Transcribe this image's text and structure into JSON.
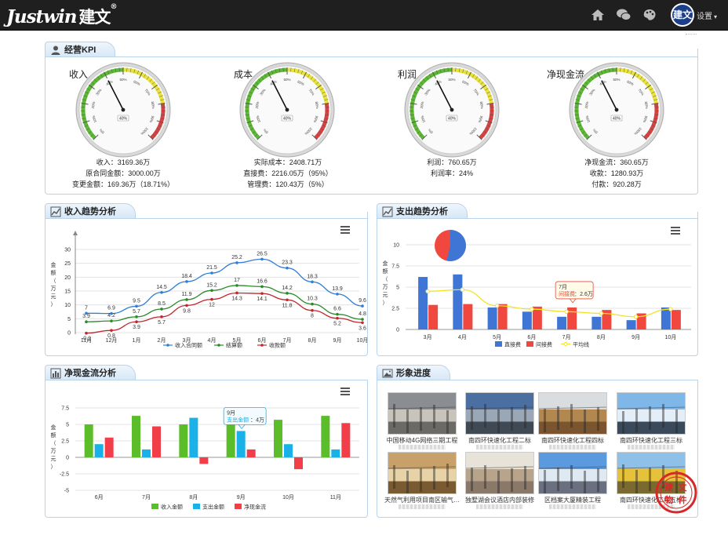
{
  "header": {
    "logo_text": "Justwin",
    "logo_cn": "建文",
    "logo_mark": "®",
    "avatar_text": "建文",
    "settings_label": "设置"
  },
  "kpi": {
    "title": "经营KPI",
    "gauges": [
      {
        "name": "收入",
        "pointer": "40%",
        "lines": [
          "收入：3169.36万",
          "原合同金额：3000.00万",
          "变更金额：169.36万（18.71%）"
        ]
      },
      {
        "name": "成本",
        "pointer": "40%",
        "lines": [
          "实际成本：2408.71万",
          "直接费：2216.05万（95%）",
          "管理费：120.43万（5%）"
        ]
      },
      {
        "name": "利润",
        "pointer": "40%",
        "lines": [
          "利润：760.65万",
          "利润率：24%"
        ]
      },
      {
        "name": "净现金流",
        "pointer": "40%",
        "lines": [
          "净现金流：360.65万",
          "收款：1280.93万",
          "付款：920.28万"
        ]
      }
    ],
    "scale_labels": [
      "0%",
      "10%",
      "20%",
      "30%",
      "40%",
      "50%",
      "60%",
      "70%",
      "80%",
      "90%",
      "100%"
    ]
  },
  "income": {
    "title": "收入趋势分析",
    "chart_data": {
      "type": "line",
      "categories": [
        "11月",
        "12月",
        "1月",
        "2月",
        "3月",
        "4月",
        "5月",
        "6月",
        "7月",
        "8月",
        "9月",
        "10月"
      ],
      "ylabel": "金额（万元）",
      "ylim": [
        0,
        30
      ],
      "yticks": [
        0,
        5,
        10,
        15,
        20,
        25,
        30
      ],
      "series": [
        {
          "name": "收入合同额",
          "color": "#2f7ed8",
          "values": [
            7,
            6.9,
            9.5,
            14.5,
            18.4,
            21.5,
            25.2,
            26.5,
            23.3,
            18.3,
            13.9,
            9.6
          ]
        },
        {
          "name": "结算额",
          "color": "#2a8a2a",
          "values": [
            3.9,
            4.2,
            5.7,
            8.5,
            11.9,
            15.2,
            17,
            16.6,
            14.2,
            10.3,
            6.6,
            4.8
          ]
        },
        {
          "name": "收款额",
          "color": "#c0282d",
          "values": [
            -0.2,
            0.8,
            3.9,
            5.7,
            9.8,
            12,
            14.3,
            14.1,
            11.8,
            8,
            5.2,
            3.6
          ]
        }
      ],
      "label_values": [
        [
          "7",
          "6.9",
          "9.5",
          "14.5",
          "18.4",
          "21.5",
          "25.2",
          "26.5",
          "23.3",
          "18.3",
          "13.9",
          "9.6"
        ],
        [
          "3.9",
          "4.2",
          "5.7",
          "8.5",
          "11.9",
          "15.2",
          "17",
          "16.6",
          "14.2",
          "10.3",
          "6.6",
          "4.8"
        ],
        [
          "-0.2",
          "0.8",
          "3.9",
          "5.7",
          "9.8",
          "12",
          "14.3",
          "14.1",
          "11.8",
          "8",
          "5.2",
          "3.6"
        ]
      ]
    }
  },
  "expense": {
    "title": "支出趋势分析",
    "chart_data": {
      "type": "bar",
      "categories": [
        "3月",
        "4月",
        "5月",
        "6月",
        "7月",
        "8月",
        "9月",
        "10月"
      ],
      "ylabel": "金额（万元）",
      "ylim": [
        0,
        10
      ],
      "yticks": [
        0,
        2.5,
        5,
        7.5,
        10
      ],
      "series": [
        {
          "name": "直接费",
          "color": "#3f76d6",
          "values": [
            6.2,
            6.5,
            2.6,
            2.1,
            1.5,
            1.5,
            1.1,
            2.6
          ]
        },
        {
          "name": "间接费",
          "color": "#f0473f",
          "values": [
            2.9,
            3.0,
            3.0,
            2.7,
            2.6,
            2.3,
            1.9,
            2.3
          ]
        },
        {
          "name": "平均线",
          "color": "#f2e226",
          "values": [
            4.5,
            4.7,
            2.8,
            2.4,
            2.1,
            1.9,
            1.5,
            2.4
          ]
        }
      ],
      "tooltip": {
        "title": "7月",
        "label": "间接费",
        "value": "2.6万"
      }
    }
  },
  "cash": {
    "title": "净现金流分析",
    "chart_data": {
      "type": "bar",
      "categories": [
        "6月",
        "7月",
        "8月",
        "9月",
        "10月",
        "11月"
      ],
      "ylabel": "金额（万元）",
      "ylim": [
        -5,
        7.5
      ],
      "yticks": [
        -5,
        -2.5,
        0,
        2.5,
        5,
        7.5
      ],
      "series": [
        {
          "name": "收入金额",
          "color": "#5cbd2a",
          "values": [
            5,
            6.3,
            5,
            5.7,
            5.7,
            6.3
          ]
        },
        {
          "name": "支出金额",
          "color": "#19b1e8",
          "values": [
            2,
            1.2,
            6,
            4,
            2,
            1.2
          ]
        },
        {
          "name": "净现金流",
          "color": "#f23e49",
          "values": [
            3,
            4.7,
            -1,
            1.2,
            -1.8,
            5.2
          ]
        }
      ],
      "tooltip": {
        "title": "9月",
        "label": "支出金额",
        "value": "4万"
      }
    }
  },
  "progress": {
    "title": "形象进度",
    "items": [
      {
        "caption": "中国移动4G网络三期工程"
      },
      {
        "caption": "南四环快速化工程二标"
      },
      {
        "caption": "南四环快速化工程四标"
      },
      {
        "caption": "南四环快速化工程三标"
      },
      {
        "caption": "天然气利用项目南区输气…"
      },
      {
        "caption": "独墅湖会议酒店内部装修"
      },
      {
        "caption": "区档案大厦精装工程"
      },
      {
        "caption": "南四环快速化工程五标"
      }
    ],
    "stamp_text": [
      "建",
      "文",
      "物",
      "件"
    ]
  },
  "colors": {
    "panel_border": "#b9d3ea",
    "header_bg": "#1f1f1f"
  }
}
